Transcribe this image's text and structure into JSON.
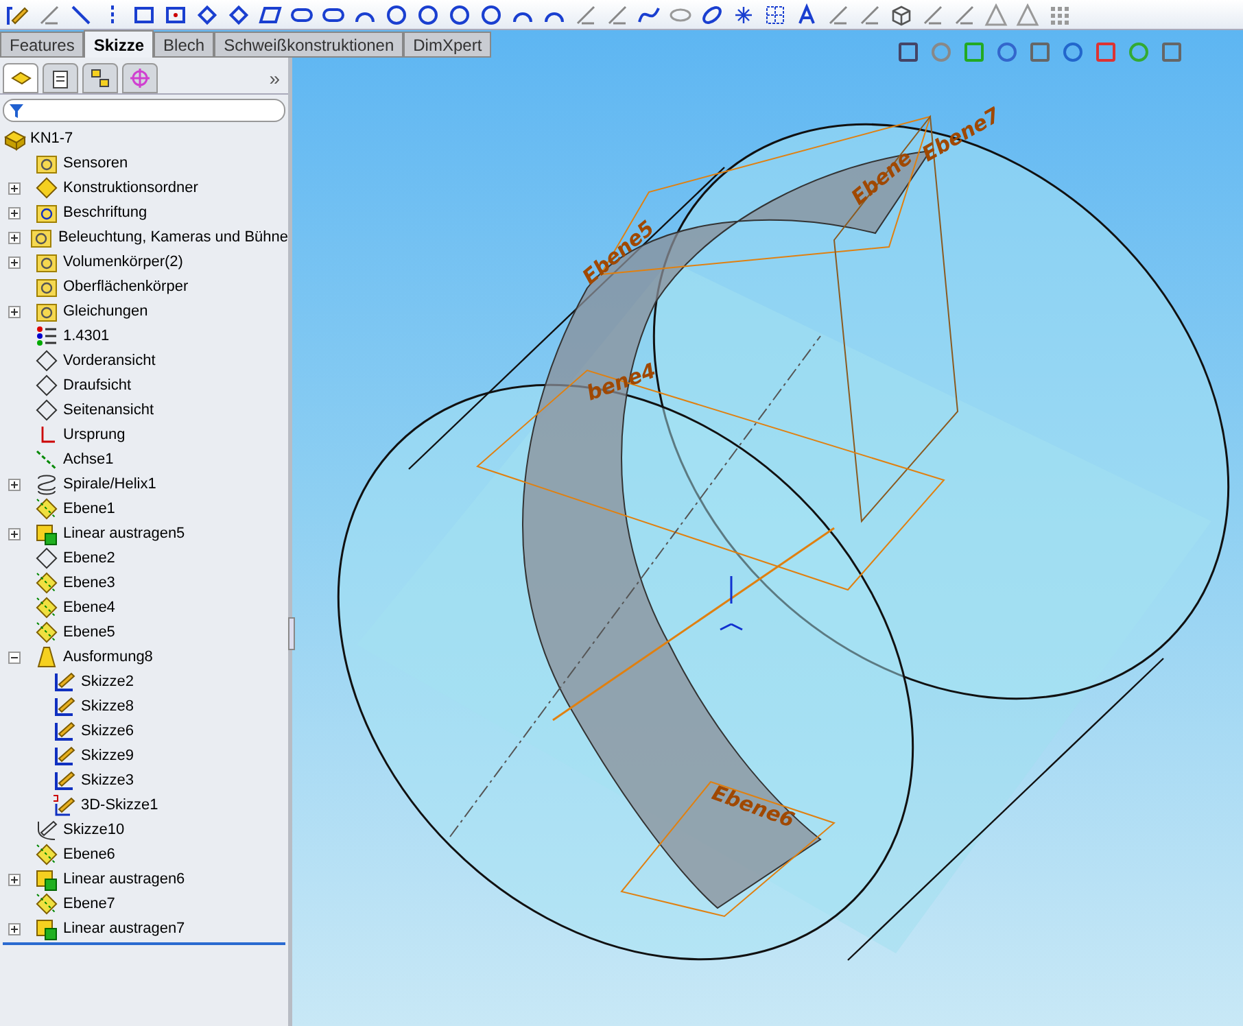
{
  "tabs": [
    {
      "label": "Features",
      "selected": false
    },
    {
      "label": "Skizze",
      "selected": true
    },
    {
      "label": "Blech",
      "selected": false
    },
    {
      "label": "Schweißkonstruktionen",
      "selected": false
    },
    {
      "label": "DimXpert",
      "selected": false
    }
  ],
  "panel_tabs": [
    {
      "kind": "tree",
      "selected": true
    },
    {
      "kind": "properties",
      "selected": false
    },
    {
      "kind": "config",
      "selected": false
    },
    {
      "kind": "target",
      "selected": false
    }
  ],
  "panel_more": "»",
  "tree": {
    "label": "KN1-7",
    "kind": "part",
    "children": [
      {
        "label": "Sensoren",
        "kind": "sensor"
      },
      {
        "label": "Konstruktionsordner",
        "kind": "design",
        "expanded": false
      },
      {
        "label": "Beschriftung",
        "kind": "annotation",
        "expanded": false
      },
      {
        "label": "Beleuchtung, Kameras und Bühne",
        "kind": "light",
        "expanded": false
      },
      {
        "label": "Volumenkörper(2)",
        "kind": "solid",
        "expanded": false
      },
      {
        "label": "Oberflächenkörper",
        "kind": "surface"
      },
      {
        "label": "Gleichungen",
        "kind": "equation",
        "expanded": false
      },
      {
        "label": "1.4301",
        "kind": "material"
      },
      {
        "label": "Vorderansicht",
        "kind": "plane"
      },
      {
        "label": "Draufsicht",
        "kind": "plane"
      },
      {
        "label": "Seitenansicht",
        "kind": "plane"
      },
      {
        "label": "Ursprung",
        "kind": "origin"
      },
      {
        "label": "Achse1",
        "kind": "axis"
      },
      {
        "label": "Spirale/Helix1",
        "kind": "helix",
        "expanded": false
      },
      {
        "label": "Ebene1",
        "kind": "refplane"
      },
      {
        "label": "Linear austragen5",
        "kind": "extrude",
        "expanded": false
      },
      {
        "label": "Ebene2",
        "kind": "plane"
      },
      {
        "label": "Ebene3",
        "kind": "refplane"
      },
      {
        "label": "Ebene4",
        "kind": "refplane"
      },
      {
        "label": "Ebene5",
        "kind": "refplane"
      },
      {
        "label": "Ausformung8",
        "kind": "loft",
        "expanded": true,
        "children": [
          {
            "label": "Skizze2",
            "kind": "sketch"
          },
          {
            "label": "Skizze8",
            "kind": "sketch"
          },
          {
            "label": "Skizze6",
            "kind": "sketch"
          },
          {
            "label": "Skizze9",
            "kind": "sketch"
          },
          {
            "label": "Skizze3",
            "kind": "sketch"
          },
          {
            "label": "3D-Skizze1",
            "kind": "sketch3d"
          }
        ]
      },
      {
        "label": "Skizze10",
        "kind": "sketchoff"
      },
      {
        "label": "Ebene6",
        "kind": "refplane"
      },
      {
        "label": "Linear austragen6",
        "kind": "extrude",
        "expanded": false
      },
      {
        "label": "Ebene7",
        "kind": "refplane"
      },
      {
        "label": "Linear austragen7",
        "kind": "extrude",
        "expanded": false
      }
    ]
  },
  "viewport": {
    "plane_labels": [
      {
        "text": "Ebene5"
      },
      {
        "text": "Ebene7"
      },
      {
        "text": "Ebene"
      },
      {
        "text": "bene4"
      },
      {
        "text": "Ebene6"
      }
    ]
  }
}
